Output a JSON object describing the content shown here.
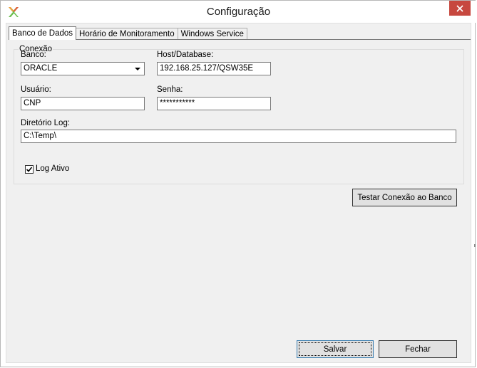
{
  "window": {
    "title": "Configuração",
    "accent_close": "#c7483f"
  },
  "tabs": [
    {
      "label": "Banco de Dados",
      "active": true
    },
    {
      "label": "Horário de Monitoramento",
      "active": false
    },
    {
      "label": "Windows Service",
      "active": false
    }
  ],
  "connection": {
    "legend": "Conexão",
    "banco_label": "Banco:",
    "banco_value": "ORACLE",
    "host_label": "Host/Database:",
    "host_value": "192.168.25.127/QSW35E",
    "usuario_label": "Usuário:",
    "usuario_value": "CNP",
    "senha_label": "Senha:",
    "senha_value": "***********",
    "diretorio_label": "Diretório Log:",
    "diretorio_value": "C:\\Temp\\",
    "log_ativo_label": "Log Ativo",
    "log_ativo_checked": true
  },
  "buttons": {
    "test_connection": "Testar Conexão ao Banco",
    "save": "Salvar",
    "close": "Fechar"
  },
  "icons": {
    "app": "app-logo-icon",
    "close": "close-icon",
    "dropdown": "chevron-down-icon",
    "check": "checkmark-icon"
  }
}
